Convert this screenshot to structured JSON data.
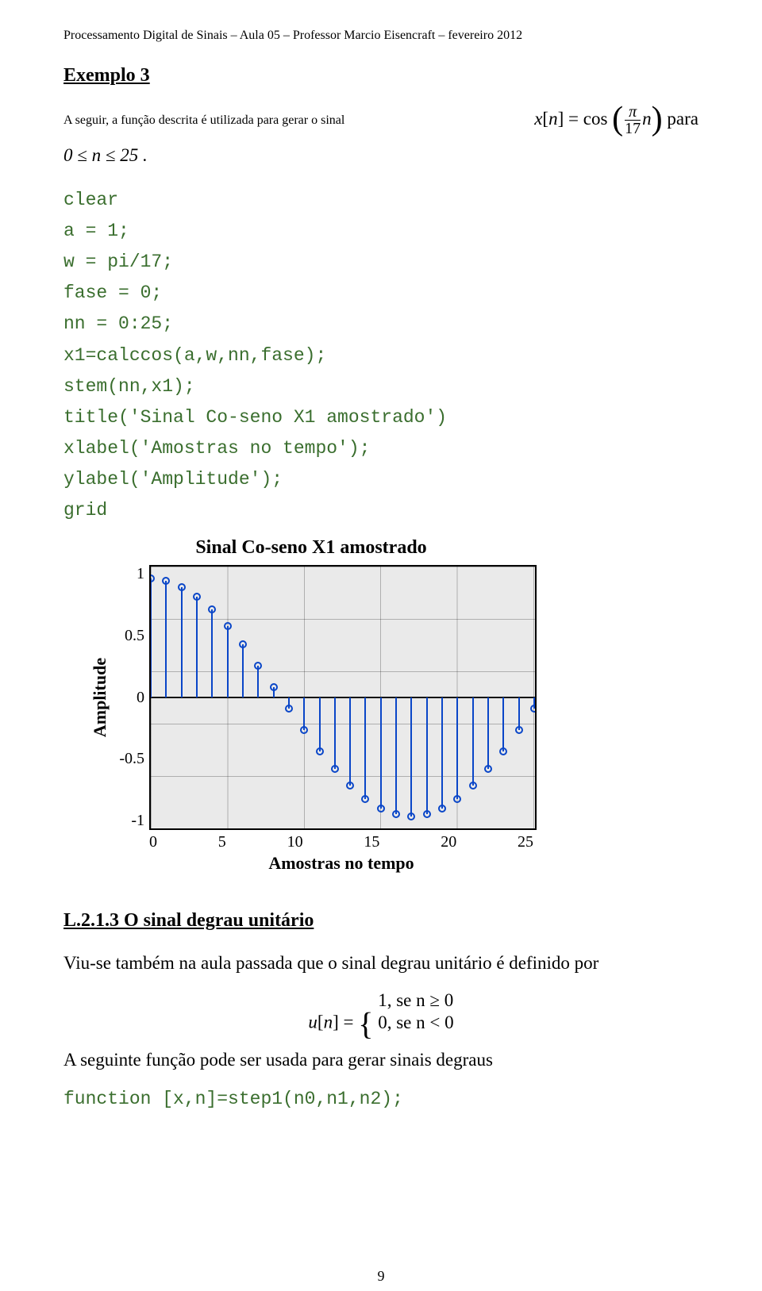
{
  "header": "Processamento Digital de Sinais – Aula 05 – Professor Marcio Eisencraft – fevereiro 2012",
  "example_heading": "Exemplo 3",
  "intro_text": "A seguir, a função descrita é utilizada para gerar o sinal ",
  "intro_eq_lhs": "x",
  "intro_eq_bracket_l": "[",
  "intro_eq_var": "n",
  "intro_eq_bracket_r": "]",
  "intro_eq_eq": "=",
  "intro_eq_fn": "cos",
  "intro_frac_num": "π",
  "intro_frac_den": "17",
  "intro_trailing_var": "n",
  "intro_para_word": " para",
  "intro_line2": "0 ≤ n ≤ 25 .",
  "code_lines": [
    "clear",
    "a = 1;",
    "w = pi/17;",
    "fase = 0;",
    "nn = 0:25;",
    "x1=calccos(a,w,nn,fase);",
    "stem(nn,x1);",
    "title('Sinal Co-seno X1 amostrado')",
    "xlabel('Amostras no tempo');",
    "ylabel('Amplitude');",
    "grid"
  ],
  "chart_title": "Sinal Co-seno X1 amostrado",
  "ylabel": "Amplitude",
  "xlabel": "Amostras no tempo",
  "yticks": [
    "1",
    "0.5",
    "0",
    "-0.5",
    "-1"
  ],
  "xticks": [
    "0",
    "5",
    "10",
    "15",
    "20",
    "25"
  ],
  "chart_data": {
    "type": "stem",
    "title": "Sinal Co-seno X1 amostrado",
    "xlabel": "Amostras no tempo",
    "ylabel": "Amplitude",
    "xlim": [
      0,
      25
    ],
    "ylim": [
      -1.1,
      1.1
    ],
    "xticks": [
      0,
      5,
      10,
      15,
      20,
      25
    ],
    "yticks": [
      -1,
      -0.5,
      0,
      0.5,
      1
    ],
    "x": [
      0,
      1,
      2,
      3,
      4,
      5,
      6,
      7,
      8,
      9,
      10,
      11,
      12,
      13,
      14,
      15,
      16,
      17,
      18,
      19,
      20,
      21,
      22,
      23,
      24,
      25
    ],
    "y": [
      1.0,
      0.98,
      0.93,
      0.85,
      0.74,
      0.6,
      0.45,
      0.27,
      0.09,
      -0.09,
      -0.27,
      -0.45,
      -0.6,
      -0.74,
      -0.85,
      -0.93,
      -0.98,
      -1.0,
      -0.98,
      -0.93,
      -0.85,
      -0.74,
      -0.6,
      -0.45,
      -0.27,
      -0.09
    ]
  },
  "section_heading": "L.2.1.3 O sinal degrau unitário",
  "step_para": "Viu-se também na aula passada que o sinal degrau unitário é definido por",
  "step_eq_lhs": "u",
  "step_eq_n": "n",
  "step_eq_case1": "1, se n ≥ 0",
  "step_eq_case2": "0, se n < 0",
  "step_para2": "A seguinte função pode ser usada para gerar sinais degraus",
  "step_code": "function [x,n]=step1(n0,n1,n2);",
  "page_number": "9"
}
